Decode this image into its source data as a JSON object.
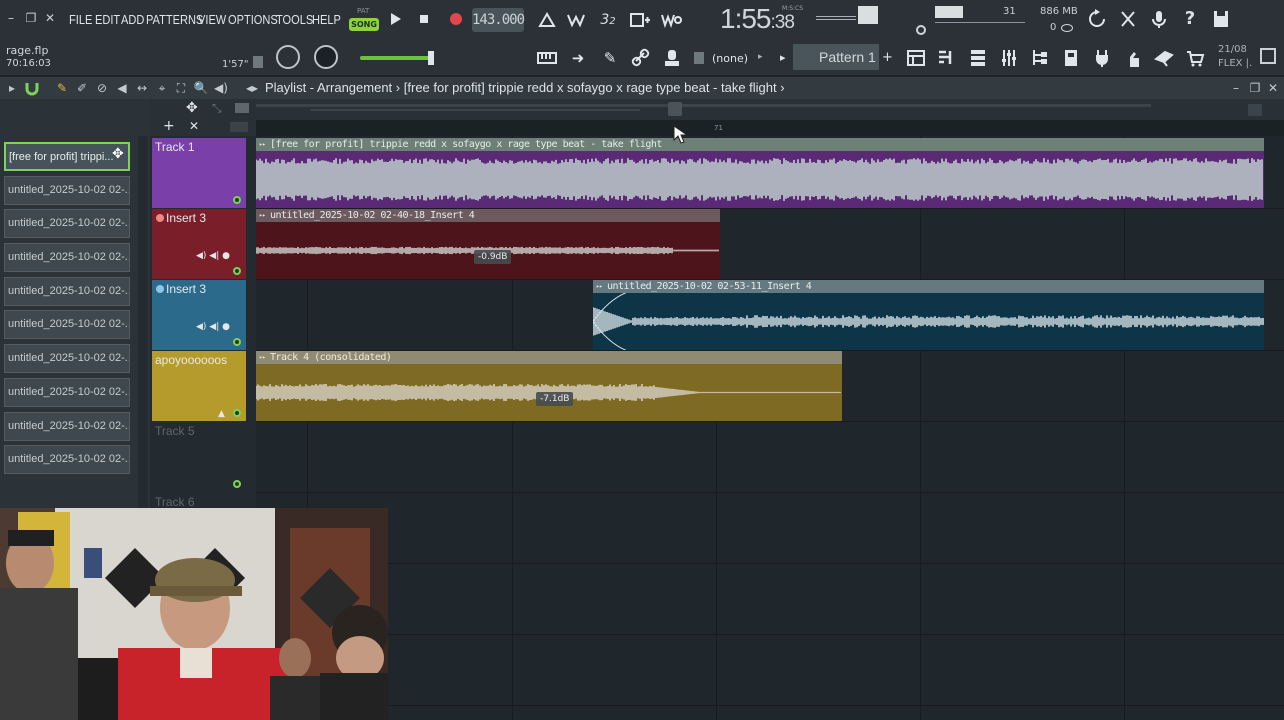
{
  "window": {
    "minimize": "–",
    "restore": "❐",
    "close": "✕"
  },
  "menu": [
    "FILE",
    "EDIT",
    "ADD",
    "PATTERNS",
    "VIEW",
    "OPTIONS",
    "TOOLS",
    "HELP"
  ],
  "transport": {
    "pat_label": "PAT",
    "song_label": "SONG",
    "tempo": "143.000",
    "time_main": "1:55",
    "time_sec": ":38",
    "time_format": "M:S:CS"
  },
  "monitor": {
    "polyphony": "31",
    "memory": "886 MB",
    "cpu": "0"
  },
  "project": {
    "file_name": "rage.flp",
    "elapsed": "70:16:03",
    "hint_time": "1'57\""
  },
  "pattern_selector": {
    "snap": "(none)",
    "pattern": "Pattern 1",
    "add": "+"
  },
  "news": {
    "date": "21/08",
    "label": "FLEX |."
  },
  "playlist": {
    "title": "Playlist - Arrangement",
    "separator": "›",
    "song_name": "[free for profit] trippie redd x sofaygo x rage type beat - take flight",
    "ruler_marker": "71"
  },
  "picker": {
    "items": [
      "[free for profit] trippi...",
      "untitled_2025-10-02 02-...",
      "untitled_2025-10-02 02-...",
      "untitled_2025-10-02 02-...",
      "untitled_2025-10-02 02-...",
      "untitled_2025-10-02 02-...",
      "untitled_2025-10-02 02-...",
      "untitled_2025-10-02 02-...",
      "untitled_2025-10-02 02-...",
      "untitled_2025-10-02 02-..."
    ]
  },
  "tracks": [
    {
      "name": "Track 1",
      "color": "#7a3fa8"
    },
    {
      "name": "Insert 3",
      "color": "#7a1f2a"
    },
    {
      "name": "Insert 3",
      "color": "#2c6a8c"
    },
    {
      "name": "apoyoooooos",
      "color": "#b59a2c"
    },
    {
      "name": "Track 5",
      "color": ""
    },
    {
      "name": "Track 6",
      "color": ""
    }
  ],
  "clips": [
    {
      "label": "[free for profit] trippie redd x sofaygo x rage type beat - take flight",
      "color": "#5a2a77"
    },
    {
      "label": "untitled_2025-10-02 02-40-18_Insert 4",
      "color": "#4d141b",
      "gain": "-0.9dB"
    },
    {
      "label": "untitled_2025-10-02 02-53-11_Insert 4",
      "color": "#0e3447"
    },
    {
      "label": "Track 4 (consolidated)",
      "color": "#7e6a22",
      "gain": "-7.1dB"
    }
  ]
}
